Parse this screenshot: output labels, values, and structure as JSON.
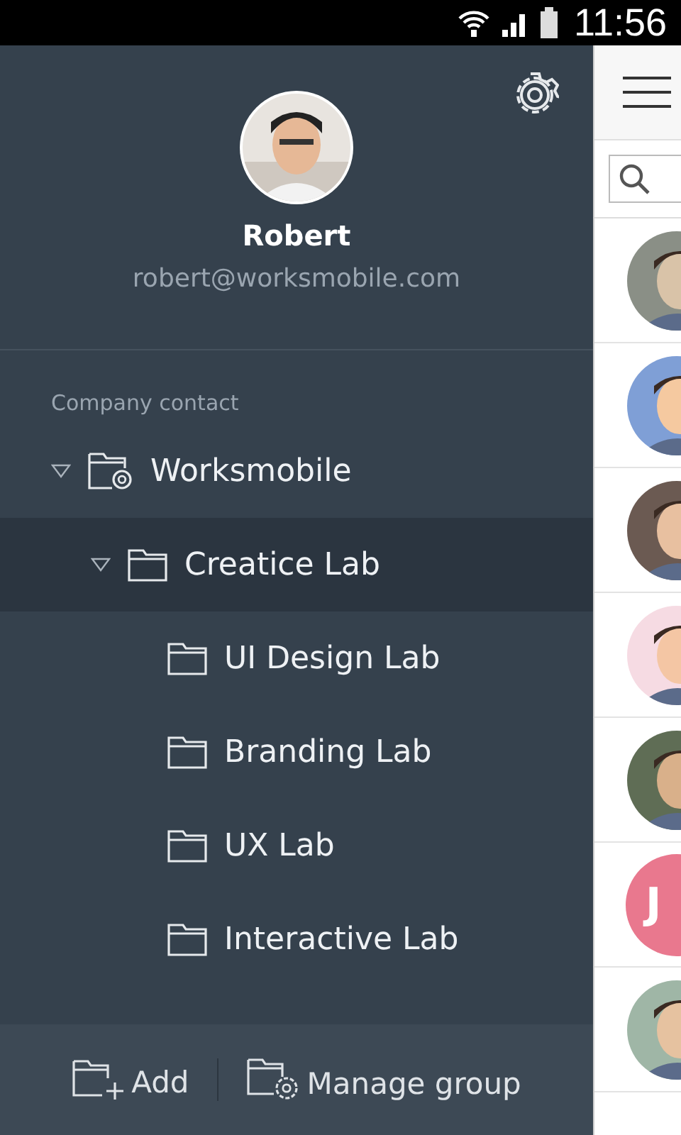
{
  "status_bar": {
    "time": "11:56"
  },
  "profile": {
    "name": "Robert",
    "email": "robert@worksmobile.com"
  },
  "section_label": "Company contact",
  "tree": [
    {
      "label": "Worksmobile",
      "kind": "company",
      "expanded": true,
      "selected": false,
      "children": [
        {
          "label": "Creatice Lab",
          "kind": "folder",
          "expanded": true,
          "selected": true,
          "children": [
            {
              "label": "UI Design Lab",
              "kind": "folder",
              "selected": false
            },
            {
              "label": "Branding Lab",
              "kind": "folder",
              "selected": false
            },
            {
              "label": "UX Lab",
              "kind": "folder",
              "selected": false
            },
            {
              "label": "Interactive Lab",
              "kind": "folder",
              "selected": false
            }
          ]
        }
      ]
    }
  ],
  "footer": [
    {
      "label": "Add",
      "kind": "add"
    },
    {
      "label": "Manage group",
      "kind": "manage"
    }
  ],
  "contacts": [
    {
      "kind": "picture"
    },
    {
      "kind": "picture"
    },
    {
      "kind": "picture"
    },
    {
      "kind": "picture"
    },
    {
      "kind": "picture"
    },
    {
      "kind": "initial",
      "initial": "J",
      "color": "#e9788e"
    },
    {
      "kind": "picture"
    }
  ]
}
